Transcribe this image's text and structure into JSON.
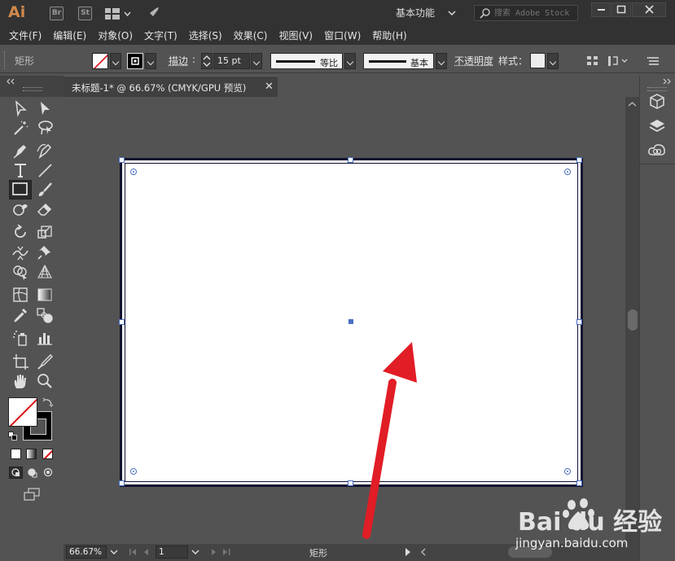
{
  "app": {
    "logo": "Ai",
    "bridge_badge": "Br",
    "stock_badge": "St",
    "workspace": "基本功能",
    "stock_search_placeholder": "搜索 Adobe Stock"
  },
  "menu": [
    "文件(F)",
    "编辑(E)",
    "对象(O)",
    "文字(T)",
    "选择(S)",
    "效果(C)",
    "视图(V)",
    "窗口(W)",
    "帮助(H)"
  ],
  "control": {
    "object_label": "矩形",
    "stroke_label": "描边",
    "stroke_weight": "15 pt",
    "profile_label": "等比",
    "brush_label": "基本",
    "opacity_label": "不透明度",
    "style_label": "样式："
  },
  "document": {
    "tab_title": "未标题-1* @ 66.67% (CMYK/GPU 预览)",
    "close_glyph": "✕"
  },
  "status": {
    "zoom": "66.67%",
    "artboard_number": "1",
    "selection_info": "矩形"
  },
  "watermark": {
    "brand": "Bai du 经验",
    "url": "jingyan.baidu.com"
  },
  "colors": {
    "accent_blue": "#4a6fbf",
    "annotation_arrow": "#e11d26",
    "app_logo": "#d0894c"
  }
}
